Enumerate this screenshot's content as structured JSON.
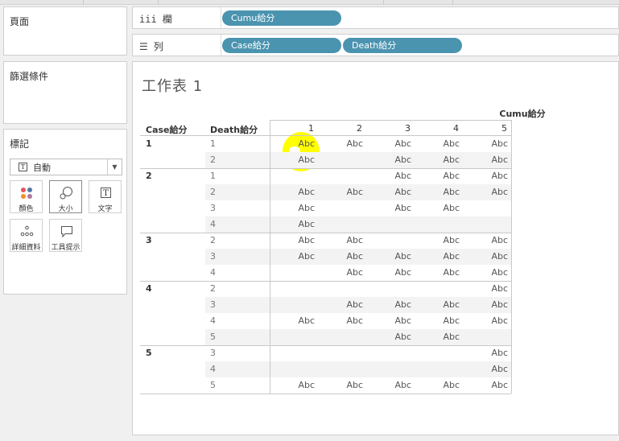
{
  "panels": {
    "pages_title": "頁面",
    "filters_title": "篩選條件",
    "marks_title": "標記"
  },
  "marks": {
    "dropdown_icon": "T",
    "dropdown_value": "自動",
    "buttons": [
      {
        "label": "顏色",
        "icon": "color-dots-icon"
      },
      {
        "label": "大小",
        "icon": "size-circles-icon"
      },
      {
        "label": "文字",
        "icon": "text-t-icon"
      },
      {
        "label": "詳細資料",
        "icon": "detail-dots-icon"
      },
      {
        "label": "工具提示",
        "icon": "tooltip-bubble-icon"
      }
    ],
    "selected_button": "大小"
  },
  "shelves": {
    "columns_label": "欄",
    "columns_pills": [
      "Cumu給分"
    ],
    "rows_label": "列",
    "rows_pills": [
      "Case給分",
      "Death給分"
    ],
    "pill_color": "#4b94b0"
  },
  "sheet": {
    "title": "工作表 1",
    "column_field": "Cumu給分",
    "row_headers": [
      "Case給分",
      "Death給分"
    ],
    "column_values": [
      "1",
      "2",
      "3",
      "4",
      "5"
    ],
    "groups": [
      {
        "case": "1",
        "rows": [
          {
            "death": "1",
            "cells": [
              "Abc",
              "Abc",
              "Abc",
              "Abc",
              "Abc"
            ]
          },
          {
            "death": "2",
            "cells": [
              "Abc",
              "",
              "Abc",
              "Abc",
              "Abc"
            ]
          }
        ]
      },
      {
        "case": "2",
        "rows": [
          {
            "death": "1",
            "cells": [
              "",
              "",
              "Abc",
              "Abc",
              "Abc"
            ]
          },
          {
            "death": "2",
            "cells": [
              "Abc",
              "Abc",
              "Abc",
              "Abc",
              "Abc"
            ]
          },
          {
            "death": "3",
            "cells": [
              "Abc",
              "",
              "Abc",
              "Abc",
              ""
            ]
          },
          {
            "death": "4",
            "cells": [
              "Abc",
              "",
              "",
              "",
              ""
            ]
          }
        ]
      },
      {
        "case": "3",
        "rows": [
          {
            "death": "2",
            "cells": [
              "Abc",
              "Abc",
              "",
              "Abc",
              "Abc"
            ]
          },
          {
            "death": "3",
            "cells": [
              "Abc",
              "Abc",
              "Abc",
              "Abc",
              "Abc"
            ]
          },
          {
            "death": "4",
            "cells": [
              "",
              "Abc",
              "Abc",
              "Abc",
              "Abc"
            ]
          }
        ]
      },
      {
        "case": "4",
        "rows": [
          {
            "death": "2",
            "cells": [
              "",
              "",
              "",
              "",
              "Abc"
            ]
          },
          {
            "death": "3",
            "cells": [
              "",
              "Abc",
              "Abc",
              "Abc",
              "Abc"
            ]
          },
          {
            "death": "4",
            "cells": [
              "Abc",
              "Abc",
              "Abc",
              "Abc",
              "Abc"
            ]
          },
          {
            "death": "5",
            "cells": [
              "",
              "",
              "Abc",
              "Abc",
              ""
            ]
          }
        ]
      },
      {
        "case": "5",
        "rows": [
          {
            "death": "3",
            "cells": [
              "",
              "",
              "",
              "",
              "Abc"
            ]
          },
          {
            "death": "4",
            "cells": [
              "",
              "",
              "",
              "",
              "Abc"
            ]
          },
          {
            "death": "5",
            "cells": [
              "Abc",
              "Abc",
              "Abc",
              "Abc",
              "Abc"
            ]
          }
        ]
      }
    ]
  },
  "annotation": {
    "highlight_color": "#ffff00"
  }
}
